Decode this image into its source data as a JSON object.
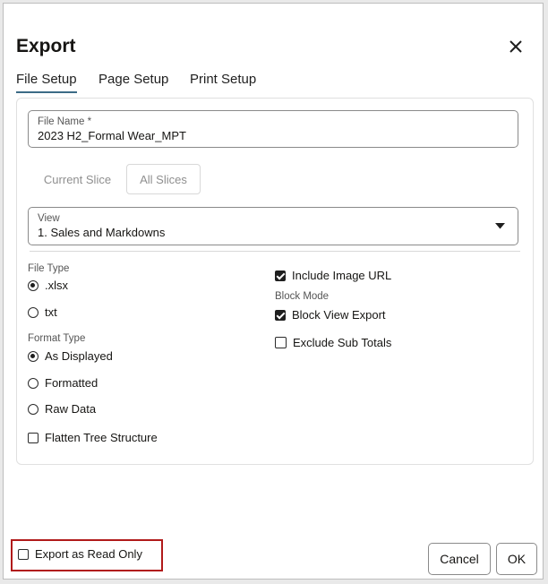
{
  "dialog": {
    "title": "Export"
  },
  "tabs": [
    {
      "label": "File Setup",
      "active": true
    },
    {
      "label": "Page Setup",
      "active": false
    },
    {
      "label": "Print Setup",
      "active": false
    }
  ],
  "file_name": {
    "label": "File Name *",
    "value": "2023 H2_Formal Wear_MPT"
  },
  "slice_options": [
    {
      "label": "Current Slice",
      "selected": false
    },
    {
      "label": "All Slices",
      "selected": true
    }
  ],
  "view": {
    "label": "View",
    "value": "1. Sales and Markdowns"
  },
  "file_type": {
    "label": "File Type",
    "options": [
      {
        "label": ".xlsx",
        "selected": true
      },
      {
        "label": "txt",
        "selected": false
      }
    ]
  },
  "format_type": {
    "label": "Format Type",
    "options": [
      {
        "label": "As Displayed",
        "selected": true
      },
      {
        "label": "Formatted",
        "selected": false
      },
      {
        "label": "Raw Data",
        "selected": false
      }
    ]
  },
  "flatten_tree": {
    "label": "Flatten Tree Structure",
    "checked": false
  },
  "include_image_url": {
    "label": "Include Image URL",
    "checked": true
  },
  "block_mode": {
    "label": "Block Mode"
  },
  "block_view_export": {
    "label": "Block View Export",
    "checked": true
  },
  "exclude_sub_totals": {
    "label": "Exclude Sub Totals",
    "checked": false
  },
  "export_read_only": {
    "label": "Export as Read Only",
    "checked": false
  },
  "buttons": {
    "cancel": "Cancel",
    "ok": "OK"
  },
  "colors": {
    "tab_underline": "#3c6b86",
    "highlight": "#b11a1a"
  }
}
